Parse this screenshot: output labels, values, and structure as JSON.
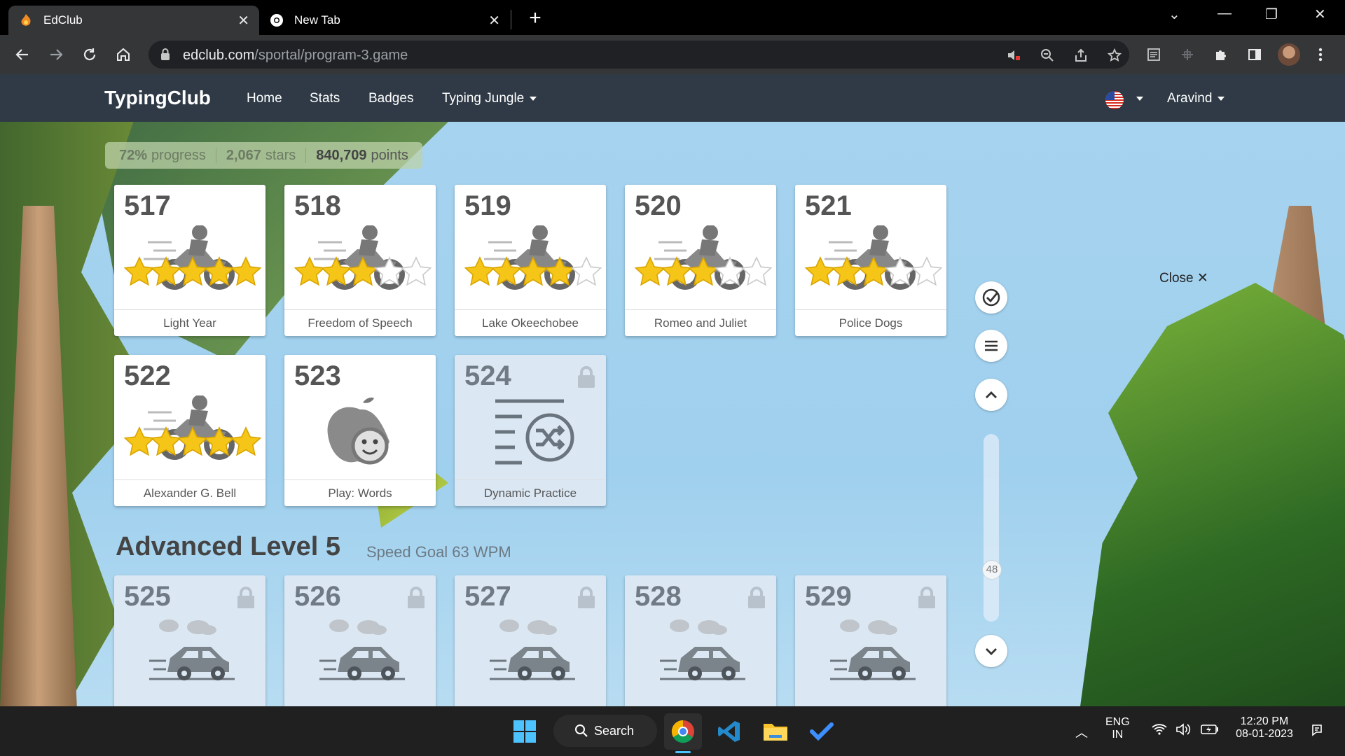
{
  "browser": {
    "tabs": [
      {
        "title": "EdClub",
        "active": true
      },
      {
        "title": "New Tab",
        "active": false
      }
    ],
    "url_domain": "edclub.com",
    "url_path": "/sportal/program-3.game"
  },
  "site": {
    "brand": "TypingClub",
    "nav": [
      {
        "label": "Home"
      },
      {
        "label": "Stats"
      },
      {
        "label": "Badges"
      },
      {
        "label": "Typing Jungle"
      }
    ],
    "user": "Aravind"
  },
  "progress": {
    "percent_value": "72%",
    "percent_label": "progress",
    "stars_value": "2,067",
    "stars_label": "stars",
    "points_value": "840,709",
    "points_label": "points"
  },
  "lessons": [
    {
      "number": "517",
      "title": "Light Year",
      "stars": 5,
      "icon": "motorcycle-icon",
      "locked": false
    },
    {
      "number": "518",
      "title": "Freedom of Speech",
      "stars": 3,
      "icon": "motorcycle-icon",
      "locked": false
    },
    {
      "number": "519",
      "title": "Lake Okeechobee",
      "stars": 4,
      "icon": "motorcycle-icon",
      "locked": false
    },
    {
      "number": "520",
      "title": "Romeo and Juliet",
      "stars": 3,
      "icon": "motorcycle-icon",
      "locked": false
    },
    {
      "number": "521",
      "title": "Police Dogs",
      "stars": 3,
      "icon": "motorcycle-icon",
      "locked": false
    },
    {
      "number": "522",
      "title": "Alexander G. Bell",
      "stars": 5,
      "icon": "motorcycle-icon",
      "locked": false
    },
    {
      "number": "523",
      "title": "Play: Words",
      "stars": 0,
      "icon": "apple-game-icon",
      "locked": false
    },
    {
      "number": "524",
      "title": "Dynamic Practice",
      "stars": 0,
      "icon": "shuffle-list-icon",
      "locked": true
    }
  ],
  "section": {
    "title": "Advanced Level 5",
    "subtitle": "Speed Goal 63 WPM",
    "lessons": [
      {
        "number": "525",
        "locked": true,
        "icon": "car-icon"
      },
      {
        "number": "526",
        "locked": true,
        "icon": "car-icon"
      },
      {
        "number": "527",
        "locked": true,
        "icon": "car-icon"
      },
      {
        "number": "528",
        "locked": true,
        "icon": "car-icon"
      },
      {
        "number": "529",
        "locked": true,
        "icon": "car-icon"
      }
    ]
  },
  "sidebar": {
    "slider_value": "48",
    "close_label": "Close"
  },
  "taskbar": {
    "search_label": "Search",
    "lang_top": "ENG",
    "lang_bottom": "IN",
    "time": "12:20 PM",
    "date": "08-01-2023"
  },
  "colors": {
    "star": "#f5c518",
    "header": "#2f3a46",
    "sky": "#a6d3ef"
  }
}
